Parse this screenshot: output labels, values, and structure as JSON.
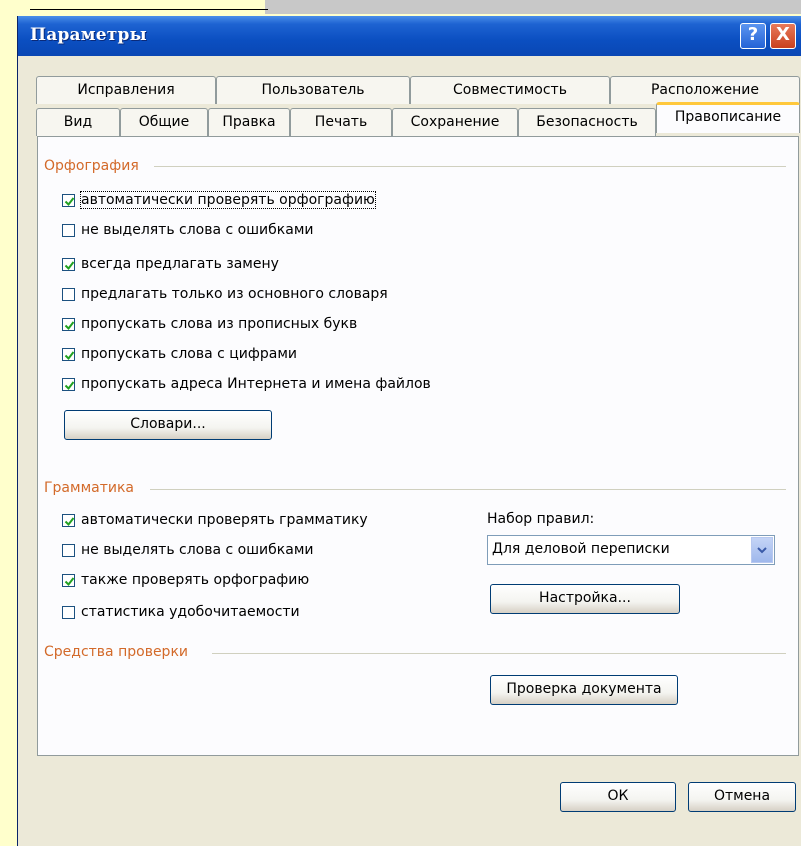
{
  "window": {
    "title": "Параметры",
    "help_label": "?",
    "close_label": "X"
  },
  "tabs_row1": [
    "Исправления",
    "Пользователь",
    "Совместимость",
    "Расположение"
  ],
  "tabs_row2": [
    "Вид",
    "Общие",
    "Правка",
    "Печать",
    "Сохранение",
    "Безопасность",
    "Правописание"
  ],
  "active_tab": "Правописание",
  "spelling": {
    "title": "Орфография",
    "options": [
      {
        "label": "автоматически проверять орфографию",
        "checked": true
      },
      {
        "label": "не выделять слова с ошибками",
        "checked": false
      },
      {
        "label": "всегда предлагать замену",
        "checked": true
      },
      {
        "label": "предлагать только из основного словаря",
        "checked": false
      },
      {
        "label": "пропускать слова из прописных букв",
        "checked": true
      },
      {
        "label": "пропускать слова с цифрами",
        "checked": true
      },
      {
        "label": "пропускать адреса Интернета и имена файлов",
        "checked": true
      }
    ],
    "dictionaries_button": "Словари..."
  },
  "grammar": {
    "title": "Грамматика",
    "options": [
      {
        "label": "автоматически проверять грамматику",
        "checked": true
      },
      {
        "label": "не выделять слова с ошибками",
        "checked": false
      },
      {
        "label": "также проверять орфографию",
        "checked": true
      },
      {
        "label": "статистика удобочитаемости",
        "checked": false
      }
    ],
    "ruleset_label": "Набор правил:",
    "ruleset_value": "Для деловой переписки",
    "settings_button": "Настройка..."
  },
  "proofing": {
    "title": "Средства проверки",
    "check_document_button": "Проверка документа"
  },
  "footer": {
    "ok_label": "ОК",
    "cancel_label": "Отмена"
  },
  "colors": {
    "titlebar": "#0b4fc1",
    "group_title": "#d36a2a",
    "active_tab_accent": "#ffc83c",
    "checkmark": "#21a121",
    "background": "#ffffcc"
  }
}
